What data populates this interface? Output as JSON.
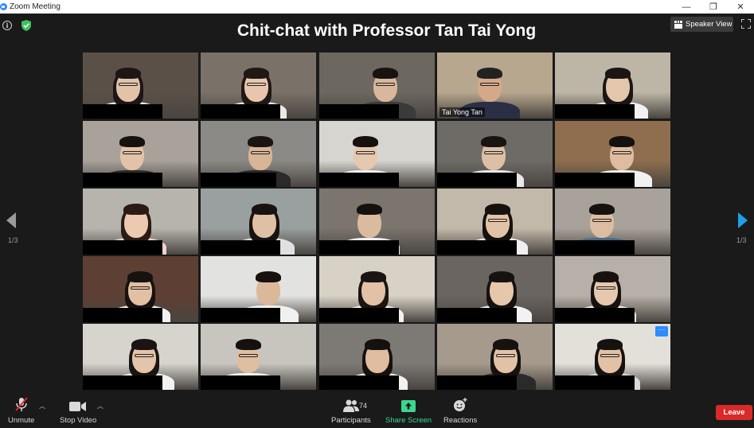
{
  "window": {
    "title": "Zoom Meeting",
    "minimize": "—",
    "restore": "❐",
    "close": "✕"
  },
  "header": {
    "meeting_title": "Chit-chat with Professor Tan Tai Yong",
    "speaker_view_label": "Speaker View",
    "info_icon": "info-icon",
    "encryption_icon": "shield-icon",
    "fullscreen_icon": "fullscreen-icon"
  },
  "gallery": {
    "page_left": "1/3",
    "page_right": "1/3",
    "active_speaker_name": "Tai Yong Tan",
    "tile_count": 25
  },
  "toolbar": {
    "unmute_label": "Unmute",
    "stop_video_label": "Stop Video",
    "participants_label": "Participants",
    "participants_count": "74",
    "share_screen_label": "Share Screen",
    "reactions_label": "Reactions",
    "leave_label": "Leave",
    "more_label": "···"
  },
  "colors": {
    "background": "#1a1a1a",
    "active_speaker_outline": "#c5f06a",
    "share_green": "#3dd68c",
    "leave_red": "#d92a2a",
    "zoom_blue": "#2d8cff",
    "nav_arrow_blue": "#1ea0e6"
  }
}
